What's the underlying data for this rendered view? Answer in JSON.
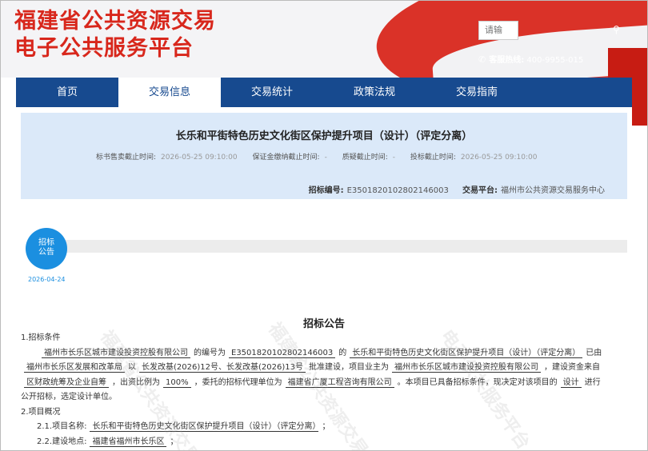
{
  "brand": {
    "line1": "福建省公共资源交易",
    "line2": "电子公共服务平台"
  },
  "search": {
    "placeholder": "请输"
  },
  "hotline": {
    "label": "客服热线:",
    "number": "400-9955-015",
    "icon": "phone-icon"
  },
  "nav": [
    {
      "label": "首页",
      "active": false
    },
    {
      "label": "交易信息",
      "active": true
    },
    {
      "label": "交易统计",
      "active": false
    },
    {
      "label": "政策法规",
      "active": false
    },
    {
      "label": "交易指南",
      "active": false
    }
  ],
  "project": {
    "title": "长乐和平街特色历史文化街区保护提升项目（设计）（评定分离）",
    "deadlines": [
      {
        "label": "标书售卖截止时间:",
        "value": "2026-05-25 09:10:00"
      },
      {
        "label": "保证金缴纳截止时间:",
        "value": "-"
      },
      {
        "label": "质疑截止时间:",
        "value": "-"
      },
      {
        "label": "投标截止时间:",
        "value": "2026-05-25 09:10:00"
      }
    ],
    "code_label": "招标编号:",
    "code": "E3501820102802146003",
    "platform_label": "交易平台:",
    "platform": "福州市公共资源交易服务中心"
  },
  "timeline": {
    "node_line1": "招标",
    "node_line2": "公告",
    "date": "2026-04-24"
  },
  "doc": {
    "title": "招标公告",
    "s1": "1.招标条件",
    "p1_owner": "福州市长乐区城市建设投资控股有限公司",
    "p1_t1": "的编号为",
    "p1_code": "E3501820102802146003",
    "p1_t2": "的",
    "p1_project": "长乐和平街特色历史文化街区保护提升项目（设计）（评定分离）",
    "p1_t3": "已由",
    "p2_approver": "福州市长乐区发展和改革局",
    "p2_t1": "以",
    "p2_docs": "长发改基(2026)12号、长发改基(2026)13号",
    "p2_t2": "批准建设，项目业主为",
    "p2_owner": "福州市长乐区城市建设投资控股有限公司",
    "p2_t3": "，建设资金来自",
    "p3_fund": "区财政统筹及企业自筹",
    "p3_t1": "，出资比例为",
    "p3_ratio": "100%",
    "p3_t2": "，委托的招标代理单位为",
    "p3_agent": "福建省广厦工程咨询有限公司",
    "p3_t3": "。本项目已具备招标条件，现决定对该项目的",
    "p3_type": "设计",
    "p3_t4": "进行",
    "p4": "公开招标，选定设计单位。",
    "s2": "2.项目概况",
    "s21_label": "2.1.项目名称:",
    "s21_value": "长乐和平街特色历史文化街区保护提升项目（设计）（评定分离）",
    "s21_end": "；",
    "s22_label": "2.2.建设地点:",
    "s22_value": "福建省福州市长乐区",
    "s22_end": "；"
  }
}
